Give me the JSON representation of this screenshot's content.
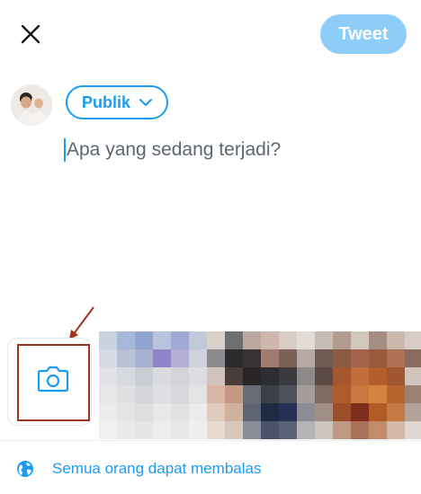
{
  "header": {
    "close_icon": "close-icon",
    "tweet_label": "Tweet"
  },
  "compose": {
    "audience_label": "Publik",
    "audience_icon": "chevron-down-icon",
    "placeholder": "Apa yang sedang terjadi?"
  },
  "media": {
    "camera_icon": "camera-icon"
  },
  "footer": {
    "reply_icon": "globe-icon",
    "reply_label": "Semua orang dapat membalas"
  },
  "colors": {
    "accent": "#1d9bf0",
    "tweet_disabled": "#8ecdf7",
    "annotation": "#a0341c"
  }
}
